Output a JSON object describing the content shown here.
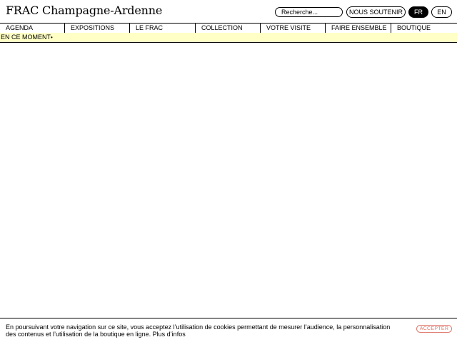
{
  "header": {
    "logo": "FRAC Champagne-Ardenne",
    "search_placeholder": "Recherche...",
    "support_label": "NOUS SOUTENIR",
    "lang_fr": "FR",
    "lang_en": "EN"
  },
  "nav": {
    "items": [
      {
        "label": "AGENDA"
      },
      {
        "label": "EXPOSITIONS"
      },
      {
        "label": "LE FRAC"
      },
      {
        "label": "COLLECTION"
      },
      {
        "label": "VOTRE VISITE"
      },
      {
        "label": "FAIRE ENSEMBLE"
      },
      {
        "label": "BOUTIQUE"
      }
    ]
  },
  "now_bar": {
    "label": "EN CE MOMENT",
    "dot": "•"
  },
  "cookie": {
    "text": "En poursuivant votre navigation sur ce site, vous acceptez l’utilisation de cookies permettant de mesurer l’audience, la personnalisation des contenus et l’utilisation de la boutique en ligne.",
    "more_link": "Plus d’infos",
    "accept_label": "ACCEPTER"
  },
  "colors": {
    "now_bar_bg": "#ffffc6",
    "accept_accent": "#e07a6f",
    "active_lang_bg": "#000000"
  }
}
